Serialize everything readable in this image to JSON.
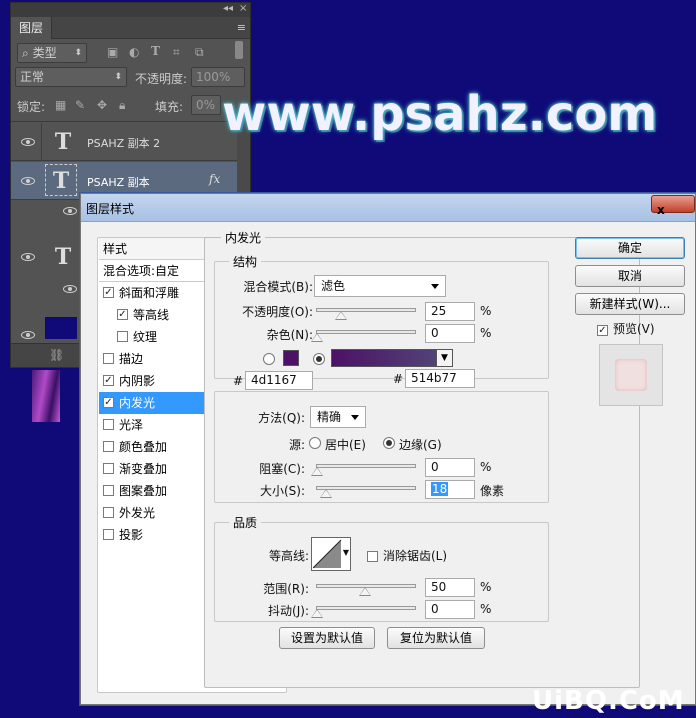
{
  "layers_panel": {
    "tab_label": "图层",
    "filter_label": "类型",
    "blend_mode": "正常",
    "opacity_label": "不透明度:",
    "opacity_value": "100%",
    "lock_label": "锁定:",
    "fill_label": "填充:",
    "fill_value": "0%",
    "layers": [
      {
        "name": "PSAHZ 副本 2"
      },
      {
        "name": "PSAHZ 副本",
        "fx": "fx"
      }
    ],
    "text_thumb": "T"
  },
  "watermark": "www.psahz.com",
  "site_logo": "UiBQ.CoM",
  "dialog": {
    "title": "图层样式",
    "close_symbol": "x",
    "nav": {
      "styles_header": "样式",
      "blend_options": "混合选项:自定",
      "items": [
        {
          "label": "斜面和浮雕",
          "checked": true
        },
        {
          "label": "等高线",
          "checked": true,
          "indent": true
        },
        {
          "label": "纹理",
          "checked": false,
          "indent": true
        },
        {
          "label": "描边",
          "checked": false
        },
        {
          "label": "内阴影",
          "checked": true
        },
        {
          "label": "内发光",
          "checked": true,
          "selected": true
        },
        {
          "label": "光泽",
          "checked": false
        },
        {
          "label": "颜色叠加",
          "checked": false
        },
        {
          "label": "渐变叠加",
          "checked": false
        },
        {
          "label": "图案叠加",
          "checked": false
        },
        {
          "label": "外发光",
          "checked": false
        },
        {
          "label": "投影",
          "checked": false
        }
      ]
    },
    "panel": {
      "title": "内发光",
      "structure": {
        "legend": "结构",
        "blend_mode_label": "混合模式(B):",
        "blend_mode_value": "滤色",
        "opacity_label": "不透明度(O):",
        "opacity_value": "25",
        "noise_label": "杂色(N):",
        "noise_value": "0",
        "percent": "%",
        "color_hex": "4d1167",
        "gradient_hex": "514b77",
        "hash": "#"
      },
      "elements": {
        "technique_label": "方法(Q):",
        "technique_value": "精确",
        "source_label": "源:",
        "source_center": "居中(E)",
        "source_edge": "边缘(G)",
        "choke_label": "阻塞(C):",
        "choke_value": "0",
        "size_label": "大小(S):",
        "size_value": "18",
        "size_unit": "像素"
      },
      "quality": {
        "legend": "品质",
        "contour_label": "等高线:",
        "antialias_label": "消除锯齿(L)",
        "range_label": "范围(R):",
        "range_value": "50",
        "jitter_label": "抖动(J):",
        "jitter_value": "0"
      },
      "set_default_button": "设置为默认值",
      "reset_default_button": "复位为默认值"
    },
    "buttons": {
      "ok": "确定",
      "cancel": "取消",
      "new_style": "新建样式(W)...",
      "preview_label": "预览(V)"
    }
  },
  "colors": {
    "canvas_bg": "#0f0a78",
    "glow_color": "#4d1167",
    "gradient_start": "#514b77",
    "selected_nav": "#3399ff"
  }
}
